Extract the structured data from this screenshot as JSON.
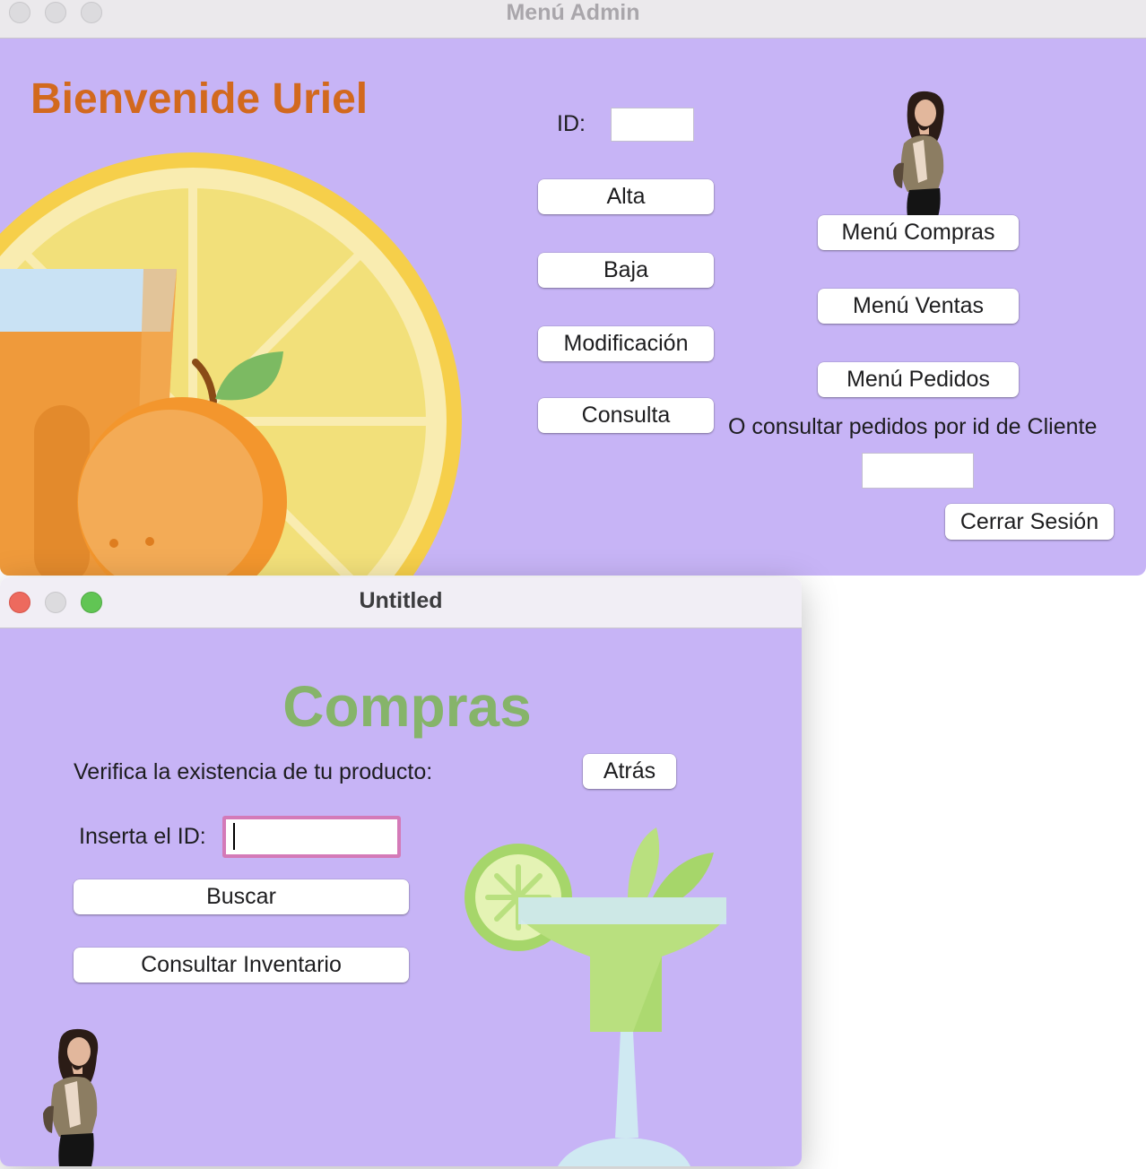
{
  "admin_window": {
    "title": "Menú Admin",
    "welcome": "Bienvenide Uriel",
    "id_label": "ID:",
    "id_value": "",
    "buttons": {
      "alta": "Alta",
      "baja": "Baja",
      "modificacion": "Modificación",
      "consulta": "Consulta",
      "menu_compras": "Menú Compras",
      "menu_ventas": "Menú Ventas",
      "menu_pedidos": "Menú Pedidos",
      "cerrar_sesion": "Cerrar Sesión"
    },
    "consult_label": "O consultar pedidos por id de Cliente",
    "client_id_value": ""
  },
  "compras_window": {
    "title": "Untitled",
    "heading": "Compras",
    "verify_label": "Verifica la existencia de tu producto:",
    "back_button": "Atrás",
    "insert_id_label": "Inserta el ID:",
    "insert_id_value": "",
    "search_button": "Buscar",
    "inventory_button": "Consultar Inventario"
  },
  "colors": {
    "window_bg": "#c7b4f6",
    "welcome_text": "#d2691e",
    "heading_text": "#86b46a",
    "focus_ring": "#d47ab8",
    "traffic_red": "#ed6a5e",
    "traffic_yellow_inactive": "#dcdbde",
    "traffic_green": "#61c554"
  },
  "icons": [
    "citrus-drinks-illustration",
    "cocktail-illustration",
    "person-photo"
  ]
}
